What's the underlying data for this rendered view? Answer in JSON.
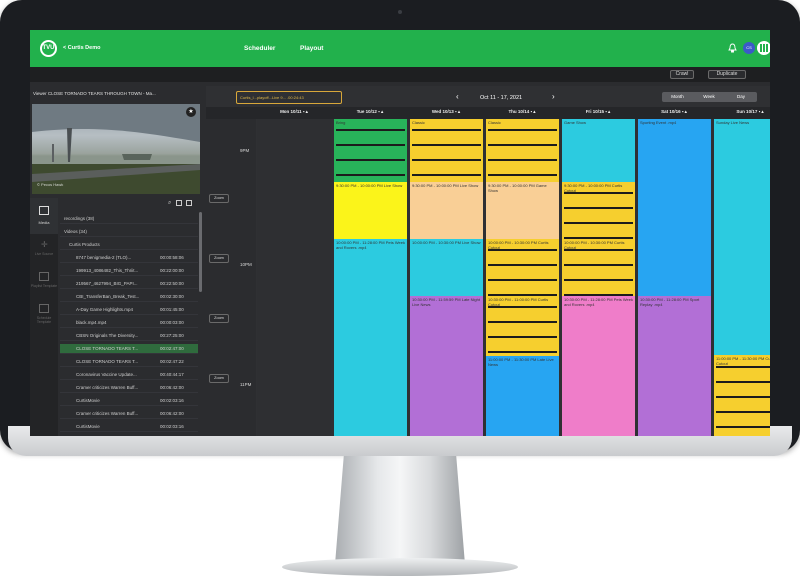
{
  "app": {
    "logo_text": "TVU",
    "back_label": "< Curtis Demo"
  },
  "nav": {
    "scheduler": "Scheduler",
    "playout": "Playout"
  },
  "user": {
    "initials": "CS"
  },
  "toolbar": {
    "crawl": "Crawl",
    "duplicate": "Duplicate"
  },
  "calendar_header": {
    "clip_chip": "Curtis_l...playoff...Live 9... .00:24:43",
    "date_range": "Oct 11 - 17, 2021",
    "views": [
      "Month",
      "Week",
      "Day"
    ]
  },
  "viewer": {
    "title": "Viewer CLOSE TORNADO TEARS THROUGH TOWN - Ma...",
    "watermark": "© Pecos Hawk"
  },
  "rail": [
    "Media",
    "Live Source",
    "Playlist Template",
    "Schedule Template"
  ],
  "tree": [
    {
      "name": "recordings (38)",
      "dur": "",
      "level": 1
    },
    {
      "name": "Videos (34)",
      "dur": "",
      "level": 1
    },
    {
      "name": "Curtis Products",
      "dur": "",
      "level": 2
    },
    {
      "name": "8747 benigmedia-2 (TLO)...",
      "dur": "00:00:58:06",
      "level": 3
    },
    {
      "name": "199913_4086482_This_Thriit...",
      "dur": "00:22:00:00",
      "level": 3
    },
    {
      "name": "219567_4627994_BIG_PAPI...",
      "dur": "00:22:50:00",
      "level": 3
    },
    {
      "name": "CBI_TransferBan_Break_Test...",
      "dur": "00:02:30:00",
      "level": 3
    },
    {
      "name": "A-Day Game Highlights.mp4",
      "dur": "00:01:45:00",
      "level": 3
    },
    {
      "name": "black.mp4.mp4",
      "dur": "00:00:03:00",
      "level": 3
    },
    {
      "name": "CBSN Originals The Diversity...",
      "dur": "00:27:25:00",
      "level": 3
    },
    {
      "name": "CLOSE TORNADO TEARS T...",
      "dur": "00:02:47:00",
      "level": 3
    },
    {
      "name": "CLOSE TORNADO TEARS T...",
      "dur": "00:02:47:22",
      "level": 3
    },
    {
      "name": "Coronavirus Vaccine Update...",
      "dur": "00:40:44:17",
      "level": 3
    },
    {
      "name": "Cramer criticizes Warren Buff...",
      "dur": "00:06:42:00",
      "level": 3
    },
    {
      "name": "CurtisMovie",
      "dur": "00:02:03:16",
      "level": 3
    },
    {
      "name": "Cramer criticizes Warren Buff...",
      "dur": "00:06:42:00",
      "level": 3
    },
    {
      "name": "CurtisMovie",
      "dur": "00:02:03:16",
      "level": 3
    }
  ],
  "days": [
    "Mon 10/11",
    "Tue 10/12",
    "Wed 10/13",
    "Thu 10/14",
    "Fri 10/15",
    "Sat 10/16",
    "Sun 10/17"
  ],
  "times": [
    "9PM",
    "10PM",
    "11PM"
  ],
  "zoom_label": "Zoom",
  "events": {
    "tue_1": "Bring",
    "tue_2": "9:30:00 PM - 10:00:00 PM Live Show",
    "tue_3": "10:00:00 PM - 11:28:00 PM Pets Week and Rovers .mp4",
    "wed_1": "Classic",
    "wed_2": "9:30:00 PM - 10:00:00 PM Live Show",
    "wed_3": "10:00:00 PM - 10:30:00 PM Live Show",
    "wed_4": "10:30:00 PM - 11:59:59 PM Late Night Live News",
    "thu_1": "Classic",
    "thu_2": "9:30:00 PM - 10:00:00 PM Game Show",
    "thu_3": "10:00:00 PM - 10:30:00 PM Curtis Cutout",
    "thu_4": "10:30:00 PM - 11:00:00 PM Curtis Cutout",
    "thu_5": "11:00:00 PM - 11:30:00 PM Late Live News",
    "fri_1": "Game Show",
    "fri_2": "9:30:00 PM - 10:00:00 PM Curtis Cutout",
    "fri_3": "10:00:00 PM - 10:30:00 PM Curtis Cutout",
    "fri_4": "10:30:00 PM - 11:28:00 PM Pets Week and Rovers .mp4",
    "sat_1": "Sporting Event .mp4",
    "sat_2": "10:30:00 PM - 11:28:00 PM Sport Replay .mp4",
    "sun_1": "Sunday Live News",
    "sun_2": "11:00:00 PM - 11:30:00 PM Curtis Cutout"
  },
  "colors": {
    "brand_green": "#22b14c",
    "yellow": "#f6cf2e",
    "bright_yellow": "#fbf41a",
    "peach": "#f9cf96",
    "cyan": "#2ccbe0",
    "blue": "#27a5f2",
    "violet": "#b26fd6",
    "green_ev": "#28b45a",
    "pink": "#ef7dc9"
  }
}
